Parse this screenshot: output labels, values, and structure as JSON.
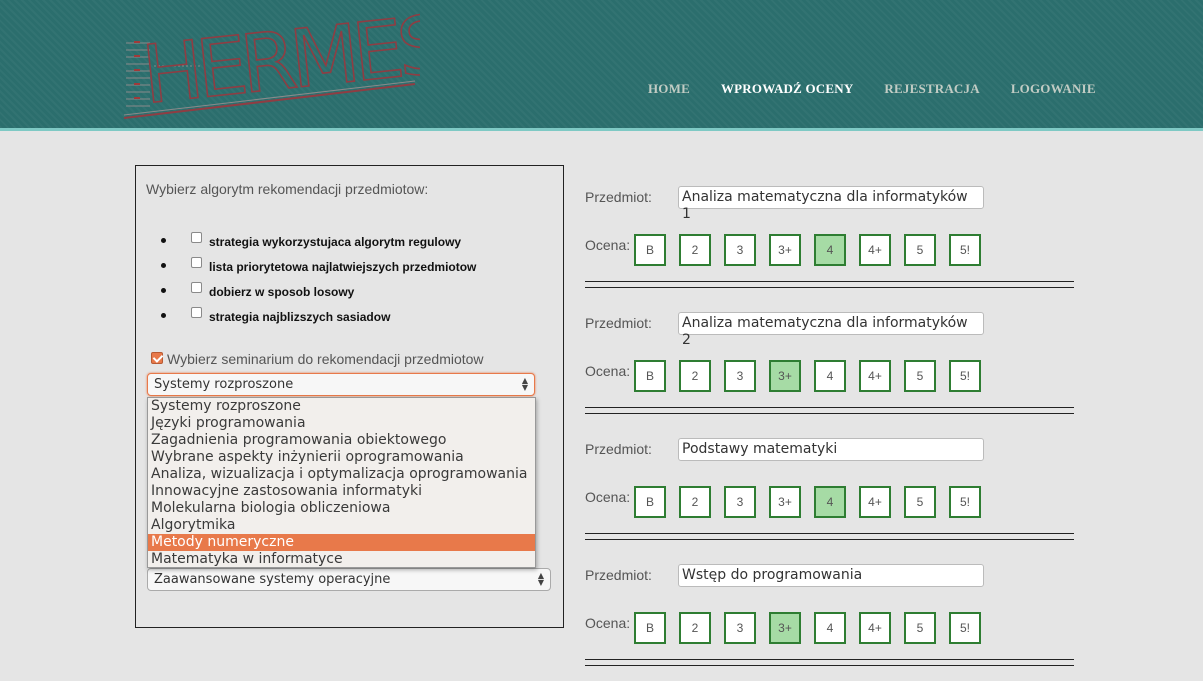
{
  "header": {
    "logo_text": "HERMES",
    "nav": [
      {
        "label": "HOME",
        "active": false
      },
      {
        "label": "WPROWADŹ OCENY",
        "active": true
      },
      {
        "label": "REJESTRACJA",
        "active": false
      },
      {
        "label": "LOGOWANIE",
        "active": false
      }
    ]
  },
  "panel": {
    "title": "Wybierz algorytm rekomendacji przedmiotow:",
    "algorithms": [
      {
        "label": "strategia wykorzystujaca algorytm regulowy",
        "checked": false
      },
      {
        "label": "lista priorytetowa najlatwiejszych przedmiotow",
        "checked": false
      },
      {
        "label": "dobierz w sposob losowy",
        "checked": false
      },
      {
        "label": "strategia najblizszych sasiadow",
        "checked": false
      }
    ],
    "seminar_label": "Wybierz seminarium do rekomendacji przedmiotow",
    "seminar_checked": true,
    "select1_value": "Systemy rozproszone",
    "select2_value": "Zaawansowane systemy operacyjne",
    "options": [
      "Systemy rozproszone",
      "Języki programowania",
      "Zagadnienia programowania obiektowego",
      "Wybrane aspekty inżynierii oprogramowania",
      "Analiza, wizualizacja i optymalizacja oprogramowania",
      "Innowacyjne zastosowania informatyki",
      "Molekularna biologia obliczeniowa",
      "Algorytmika",
      "Metody numeryczne",
      "Matematyka w informatyce"
    ],
    "highlighted_option": "Metody numeryczne"
  },
  "subject_label": "Przedmiot:",
  "grade_label": "Ocena:",
  "grades": [
    "B",
    "2",
    "3",
    "3+",
    "4",
    "4+",
    "5",
    "5!"
  ],
  "subjects": [
    {
      "name": "Analiza matematyczna dla informatyków 1",
      "selected_grade": "4"
    },
    {
      "name": "Analiza matematyczna dla informatyków 2",
      "selected_grade": "3+"
    },
    {
      "name": "Podstawy matematyki",
      "selected_grade": "4"
    },
    {
      "name": "Wstęp do programowania",
      "selected_grade": "3+"
    }
  ],
  "colors": {
    "header_bg": "#2b6e6d",
    "accent_orange": "#e8794a",
    "grade_border": "#2e7d32",
    "grade_selected": "#a6dba5"
  }
}
